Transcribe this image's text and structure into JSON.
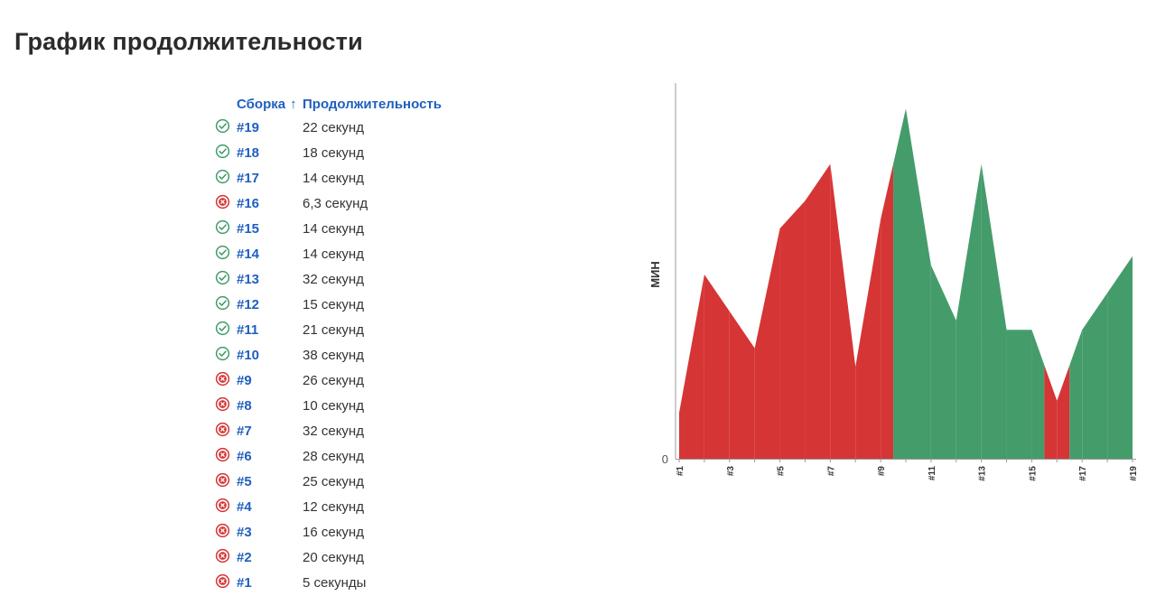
{
  "page": {
    "title": "График продолжительности"
  },
  "table": {
    "headers": {
      "build": "Сборка",
      "sort_arrow": "↑",
      "duration": "Продолжительность"
    },
    "rows": [
      {
        "status": "success",
        "build": "#19",
        "duration": "22 секунд"
      },
      {
        "status": "success",
        "build": "#18",
        "duration": "18 секунд"
      },
      {
        "status": "success",
        "build": "#17",
        "duration": "14 секунд"
      },
      {
        "status": "failure",
        "build": "#16",
        "duration": "6,3 секунд"
      },
      {
        "status": "success",
        "build": "#15",
        "duration": "14 секунд"
      },
      {
        "status": "success",
        "build": "#14",
        "duration": "14 секунд"
      },
      {
        "status": "success",
        "build": "#13",
        "duration": "32 секунд"
      },
      {
        "status": "success",
        "build": "#12",
        "duration": "15 секунд"
      },
      {
        "status": "success",
        "build": "#11",
        "duration": "21 секунд"
      },
      {
        "status": "success",
        "build": "#10",
        "duration": "38 секунд"
      },
      {
        "status": "failure",
        "build": "#9",
        "duration": "26 секунд"
      },
      {
        "status": "failure",
        "build": "#8",
        "duration": "10 секунд"
      },
      {
        "status": "failure",
        "build": "#7",
        "duration": "32 секунд"
      },
      {
        "status": "failure",
        "build": "#6",
        "duration": "28 секунд"
      },
      {
        "status": "failure",
        "build": "#5",
        "duration": "25 секунд"
      },
      {
        "status": "failure",
        "build": "#4",
        "duration": "12 секунд"
      },
      {
        "status": "failure",
        "build": "#3",
        "duration": "16 секунд"
      },
      {
        "status": "failure",
        "build": "#2",
        "duration": "20 секунд"
      },
      {
        "status": "failure",
        "build": "#1",
        "duration": "5 секунды"
      }
    ]
  },
  "colors": {
    "success": "#459c6b",
    "failure": "#d63535",
    "link": "#1f5fbf"
  },
  "chart_data": {
    "type": "area",
    "ylabel": "МИН",
    "xlabel": "",
    "x": [
      "#1",
      "#2",
      "#3",
      "#4",
      "#5",
      "#6",
      "#7",
      "#8",
      "#9",
      "#10",
      "#11",
      "#12",
      "#13",
      "#14",
      "#15",
      "#16",
      "#17",
      "#18",
      "#19"
    ],
    "x_tick_labels": [
      "#1",
      "#3",
      "#5",
      "#7",
      "#9",
      "#11",
      "#13",
      "#15",
      "#17",
      "#19"
    ],
    "y_tick_labels": [
      "0"
    ],
    "values_seconds": [
      5,
      20,
      16,
      12,
      25,
      28,
      32,
      10,
      26,
      38,
      21,
      15,
      32,
      14,
      14,
      6.3,
      14,
      18,
      22
    ],
    "status": [
      "failure",
      "failure",
      "failure",
      "failure",
      "failure",
      "failure",
      "failure",
      "failure",
      "failure",
      "success",
      "success",
      "success",
      "success",
      "success",
      "success",
      "failure",
      "success",
      "success",
      "success"
    ],
    "grid": false,
    "legend": "none"
  }
}
